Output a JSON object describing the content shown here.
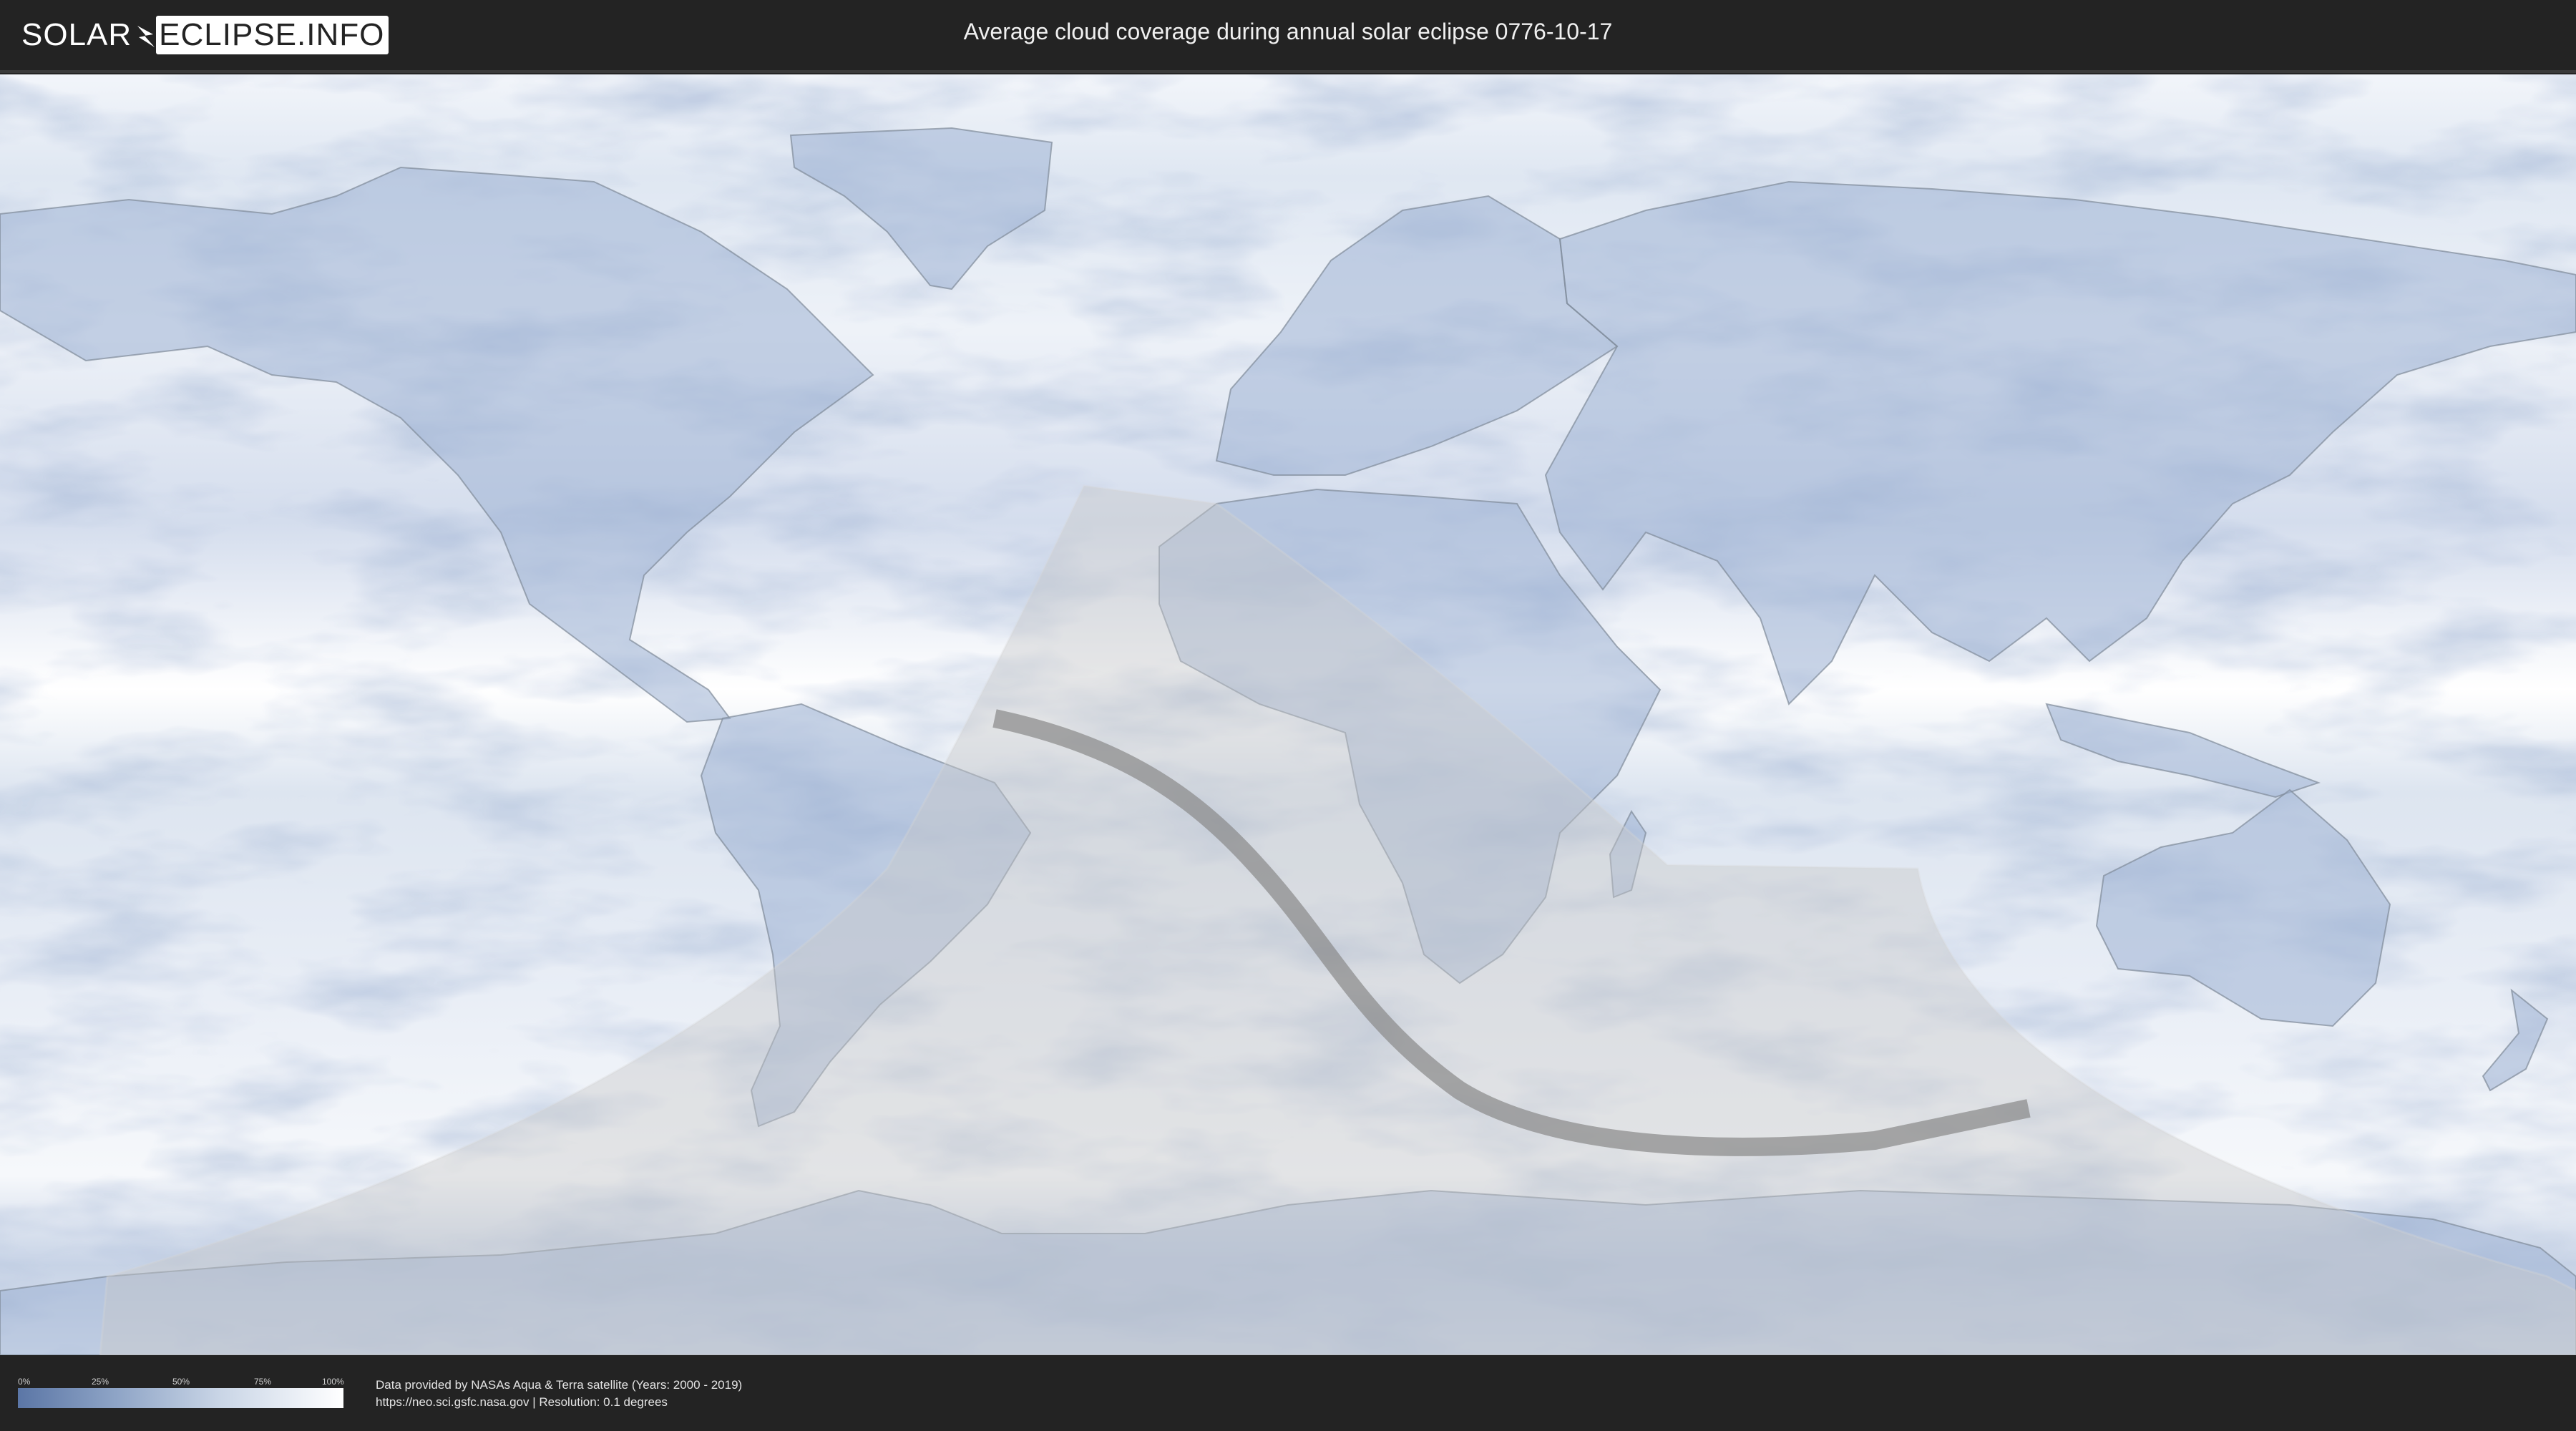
{
  "header": {
    "logo_left": "SOLAR",
    "logo_right": "ECLIPSE.INFO",
    "title": "Average cloud coverage during annual solar eclipse 0776-10-17"
  },
  "map": {
    "type": "world cloud coverage map",
    "colors": {
      "clear": "#5b76a6",
      "cloudy": "#ffffff",
      "penumbra": "#cfcfcf",
      "central_path": "#8a8a8a",
      "background": "#232323"
    }
  },
  "legend": {
    "ticks": [
      "0%",
      "25%",
      "50%",
      "75%",
      "100%"
    ]
  },
  "credits": {
    "line1": "Data provided by NASAs Aqua & Terra satellite (Years: 2000 - 2019)",
    "line2": "https://neo.sci.gsfc.nasa.gov | Resolution: 0.1 degrees"
  }
}
